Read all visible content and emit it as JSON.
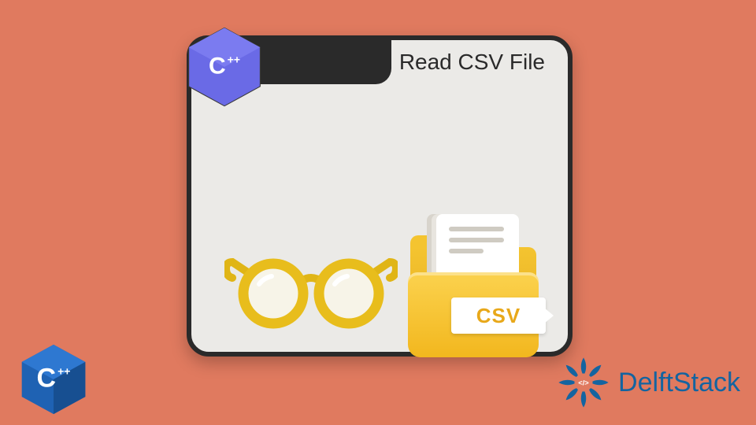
{
  "title": "Read CSV File",
  "badge": {
    "language": "C",
    "suffix": "++"
  },
  "csv": {
    "label": "CSV"
  },
  "cornerBadge": {
    "language": "C",
    "suffix": "++"
  },
  "brand": {
    "name": "DelftStack",
    "tag": "</>"
  }
}
